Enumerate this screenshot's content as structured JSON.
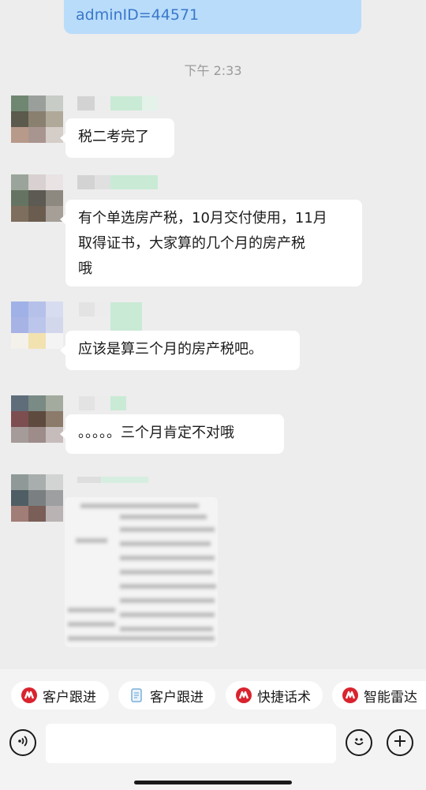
{
  "top_message": {
    "text": "adminID=44571"
  },
  "timestamp": "下午 2:33",
  "messages": [
    {
      "text": "税二考完了"
    },
    {
      "line1": "有个单选房产税，10月交付使用，11月",
      "line2": "取得证书，大家算的几个月的房产税",
      "line3": "哦"
    },
    {
      "text": "应该是算三个月的房产税吧。"
    },
    {
      "text": "。。。。。三个月肯定不对哦"
    }
  ],
  "quick_actions": [
    {
      "label": "客户跟进",
      "icon": "brand-logo-icon"
    },
    {
      "label": "客户跟进",
      "icon": "document-icon"
    },
    {
      "label": "快捷话术",
      "icon": "brand-logo-icon"
    },
    {
      "label": "智能雷达",
      "icon": "brand-logo-icon"
    }
  ],
  "input": {
    "placeholder": ""
  },
  "colors": {
    "brand_red": "#d9232e",
    "bubble_blue": "#b9dcfb",
    "link_blue": "#3a78c9"
  }
}
